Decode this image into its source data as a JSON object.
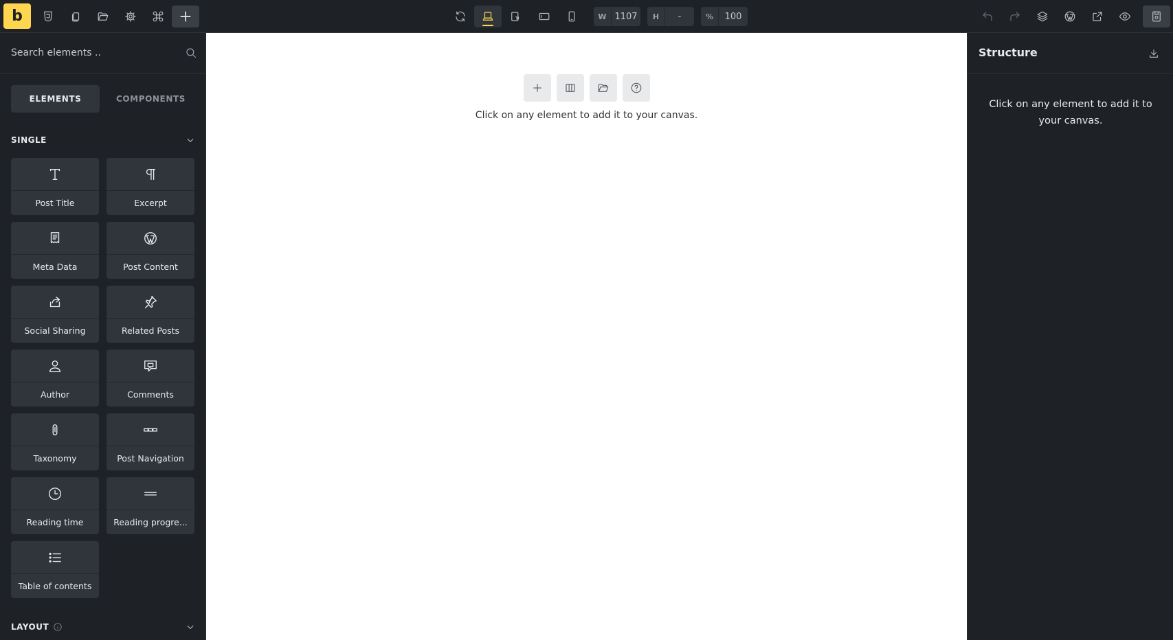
{
  "app": {
    "logo_letter": "b",
    "accent_color": "#ffd64f"
  },
  "toolbar": {
    "left_icons": [
      "html5-icon",
      "pages-icon",
      "folder-icon",
      "settings-icon",
      "command-icon",
      "add-icon"
    ],
    "center_icons": [
      "refresh-icon",
      "desktop-icon",
      "tablet-landscape-icon",
      "tablet-icon",
      "mobile-icon"
    ],
    "width_label": "W",
    "width_value": "1107",
    "height_label": "H",
    "height_value": "-",
    "zoom_label": "%",
    "zoom_value": "100",
    "right_icons": [
      "undo-icon",
      "redo-icon",
      "layers-icon",
      "wordpress-icon",
      "external-link-icon",
      "preview-eye-icon",
      "save-icon"
    ]
  },
  "sidebar": {
    "search_placeholder": "Search elements ..",
    "tabs": [
      {
        "label": "ELEMENTS",
        "active": true
      },
      {
        "label": "COMPONENTS",
        "active": false
      }
    ],
    "sections": [
      {
        "title": "SINGLE",
        "items": [
          {
            "label": "Post Title",
            "icon": "title-icon"
          },
          {
            "label": "Excerpt",
            "icon": "paragraph-icon"
          },
          {
            "label": "Meta Data",
            "icon": "meta-data-icon"
          },
          {
            "label": "Post Content",
            "icon": "wordpress-icon"
          },
          {
            "label": "Social Sharing",
            "icon": "share-icon"
          },
          {
            "label": "Related Posts",
            "icon": "pin-icon"
          },
          {
            "label": "Author",
            "icon": "user-icon"
          },
          {
            "label": "Comments",
            "icon": "comments-icon"
          },
          {
            "label": "Taxonomy",
            "icon": "clip-icon"
          },
          {
            "label": "Post Navigation",
            "icon": "navigation-icon"
          },
          {
            "label": "Reading time",
            "icon": "clock-icon"
          },
          {
            "label": "Reading progre...",
            "icon": "progress-bar-icon"
          },
          {
            "label": "Table of contents",
            "icon": "list-icon"
          }
        ]
      },
      {
        "title": "LAYOUT",
        "items": []
      }
    ]
  },
  "canvas": {
    "tools": [
      "add-icon",
      "columns-icon",
      "folder-icon",
      "help-icon"
    ],
    "message": "Click on any element to add it to your canvas."
  },
  "structure": {
    "title": "Structure",
    "message": "Click on any element to add it to your canvas."
  }
}
